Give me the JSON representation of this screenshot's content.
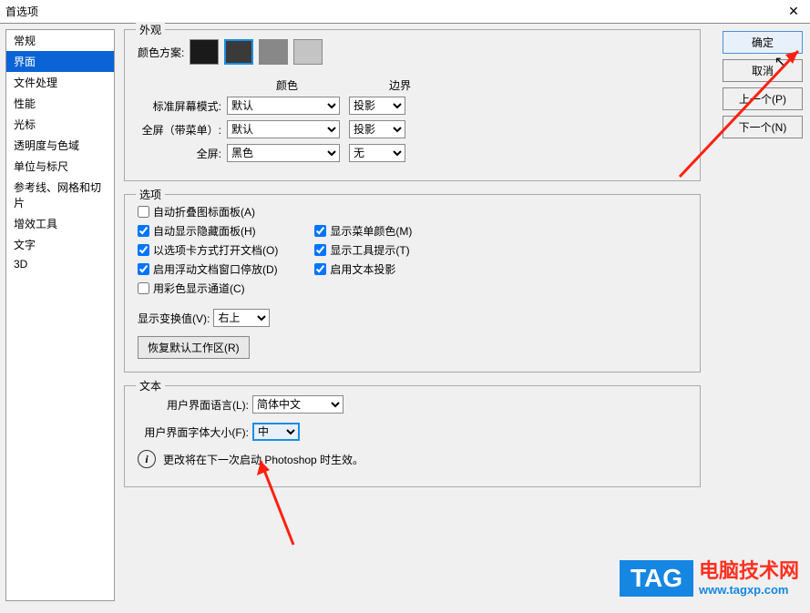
{
  "window": {
    "title": "首选项",
    "close": "✕"
  },
  "sidebar": {
    "items": [
      {
        "label": "常规"
      },
      {
        "label": "界面"
      },
      {
        "label": "文件处理"
      },
      {
        "label": "性能"
      },
      {
        "label": "光标"
      },
      {
        "label": "透明度与色域"
      },
      {
        "label": "单位与标尺"
      },
      {
        "label": "参考线、网格和切片"
      },
      {
        "label": "增效工具"
      },
      {
        "label": "文字"
      },
      {
        "label": "3D"
      }
    ],
    "selected_index": 1
  },
  "buttons": {
    "ok": "确定",
    "cancel": "取消",
    "prev": "上一个(P)",
    "next": "下一个(N)"
  },
  "appearance": {
    "legend": "外观",
    "color_scheme_label": "颜色方案:",
    "col_color": "颜色",
    "col_border": "边界",
    "rows": [
      {
        "label": "标准屏幕模式:",
        "color": "默认",
        "border": "投影"
      },
      {
        "label": "全屏（带菜单）:",
        "color": "默认",
        "border": "投影"
      },
      {
        "label": "全屏:",
        "color": "黑色",
        "border": "无"
      }
    ]
  },
  "options": {
    "legend": "选项",
    "left": [
      {
        "label": "自动折叠图标面板(A)",
        "checked": false
      },
      {
        "label": "自动显示隐藏面板(H)",
        "checked": true
      },
      {
        "label": "以选项卡方式打开文档(O)",
        "checked": true
      },
      {
        "label": "启用浮动文档窗口停放(D)",
        "checked": true
      },
      {
        "label": "用彩色显示通道(C)",
        "checked": false
      }
    ],
    "right": [
      {
        "label": "显示菜单颜色(M)",
        "checked": true
      },
      {
        "label": "显示工具提示(T)",
        "checked": true
      },
      {
        "label": "启用文本投影",
        "checked": true
      }
    ],
    "transform_label": "显示变换值(V):",
    "transform_value": "右上",
    "reset_btn": "恢复默认工作区(R)"
  },
  "text": {
    "legend": "文本",
    "lang_label": "用户界面语言(L):",
    "lang_value": "简体中文",
    "size_label": "用户界面字体大小(F):",
    "size_value": "中",
    "info": "更改将在下一次启动 Photoshop 时生效。"
  },
  "watermark": {
    "tag": "TAG",
    "t1": "电脑技术网",
    "t2": "www.tagxp.com"
  }
}
